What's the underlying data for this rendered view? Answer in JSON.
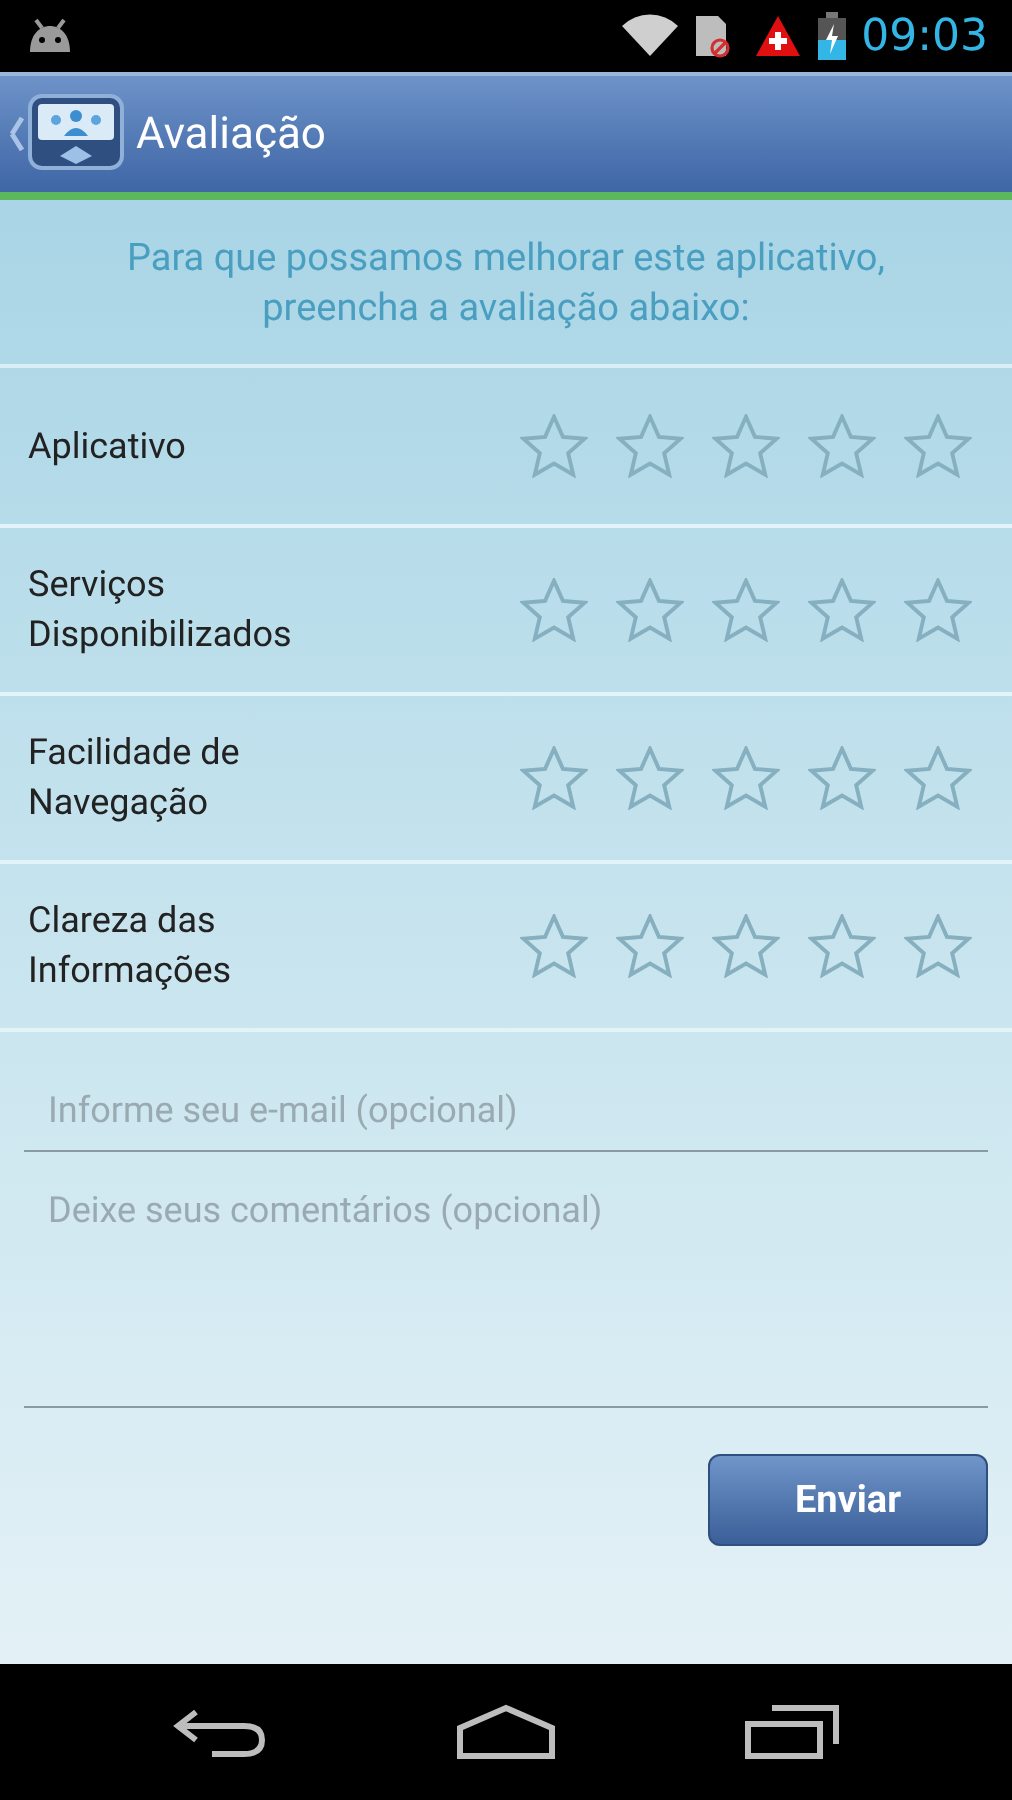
{
  "status_bar": {
    "time": "09:03"
  },
  "app_bar": {
    "title": "Avaliação"
  },
  "intro": "Para que possamos melhorar este aplicativo, preencha a avaliação abaixo:",
  "ratings": [
    {
      "label": "Aplicativo",
      "stars": 0
    },
    {
      "label": "Serviços Disponibilizados",
      "stars": 0
    },
    {
      "label": "Facilidade de Navegação",
      "stars": 0
    },
    {
      "label": "Clareza das Informações",
      "stars": 0
    }
  ],
  "email_field": {
    "placeholder": "Informe seu e-mail (opcional)"
  },
  "comments_field": {
    "placeholder": "Deixe seus comentários (opcional)"
  },
  "submit_button": "Enviar"
}
